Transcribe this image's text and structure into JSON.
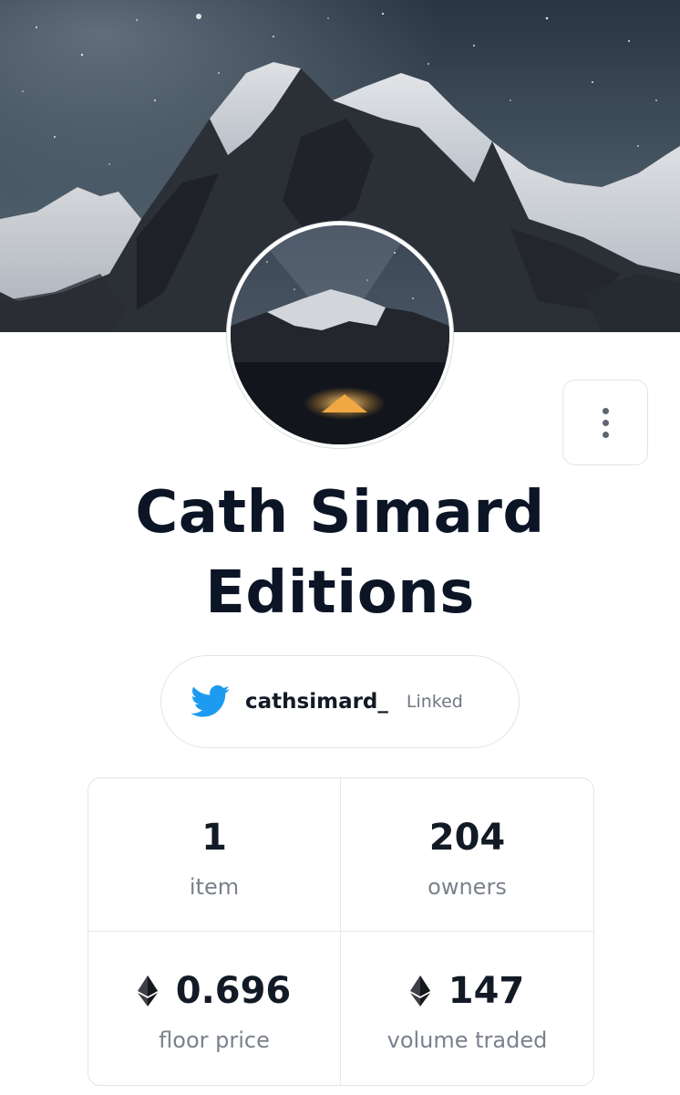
{
  "collection": {
    "title": "Cath Simard Editions"
  },
  "social": {
    "icon": "twitter-icon",
    "handle": "cathsimard_",
    "status": "Linked",
    "brand_color": "#1d9bf0"
  },
  "actions": {
    "more_icon": "more-vertical-icon"
  },
  "stats": [
    {
      "value": "1",
      "label": "item",
      "icon": null
    },
    {
      "value": "204",
      "label": "owners",
      "icon": null
    },
    {
      "value": "0.696",
      "label": "floor price",
      "icon": "ethereum-icon"
    },
    {
      "value": "147",
      "label": "volume traded",
      "icon": "ethereum-icon"
    }
  ],
  "colors": {
    "title": "#0b1526",
    "text_muted": "#7a818c",
    "border": "#e1e4e8"
  }
}
